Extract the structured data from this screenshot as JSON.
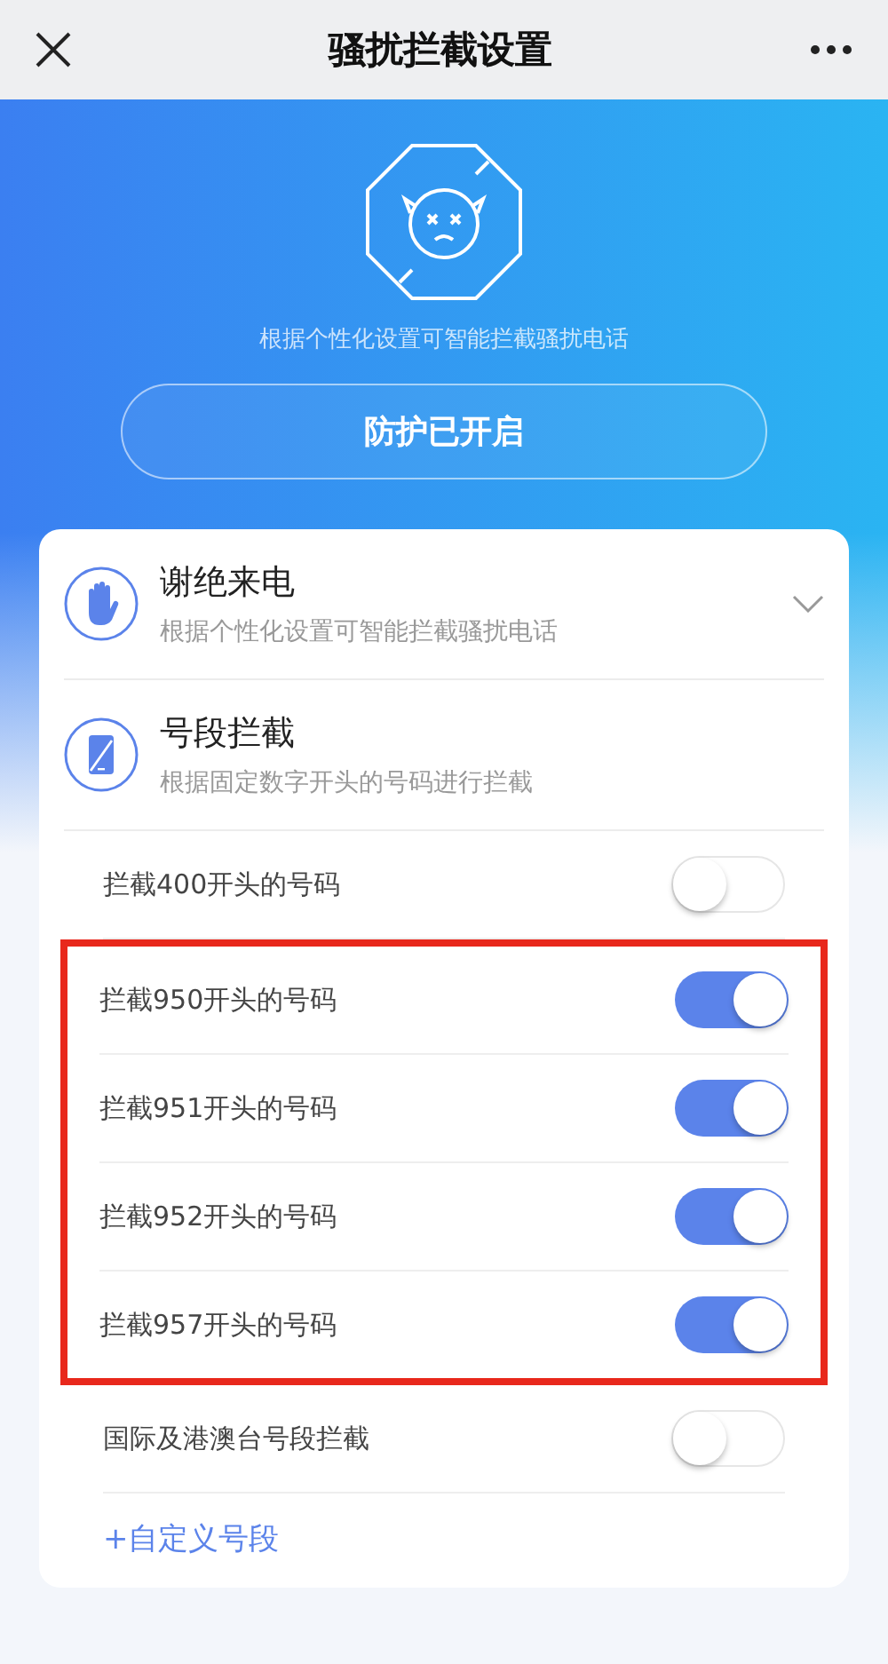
{
  "nav": {
    "title": "骚扰拦截设置"
  },
  "hero": {
    "subtitle": "根据个性化设置可智能拦截骚扰电话",
    "status_button": "防护已开启"
  },
  "sections": [
    {
      "kind": "hand",
      "title": "谢绝来电",
      "subtitle": "根据个性化设置可智能拦截骚扰电话",
      "expanded": false
    },
    {
      "kind": "phone",
      "title": "号段拦截",
      "subtitle": "根据固定数字开头的号码进行拦截"
    }
  ],
  "rules": [
    {
      "label": "拦截400开头的号码",
      "on": false,
      "highlighted": false
    },
    {
      "label": "拦截950开头的号码",
      "on": true,
      "highlighted": true
    },
    {
      "label": "拦截951开头的号码",
      "on": true,
      "highlighted": true
    },
    {
      "label": "拦截952开头的号码",
      "on": true,
      "highlighted": true
    },
    {
      "label": "拦截957开头的号码",
      "on": true,
      "highlighted": true
    },
    {
      "label": "国际及港澳台号段拦截",
      "on": false,
      "highlighted": false
    }
  ],
  "add_link": "+自定义号段"
}
